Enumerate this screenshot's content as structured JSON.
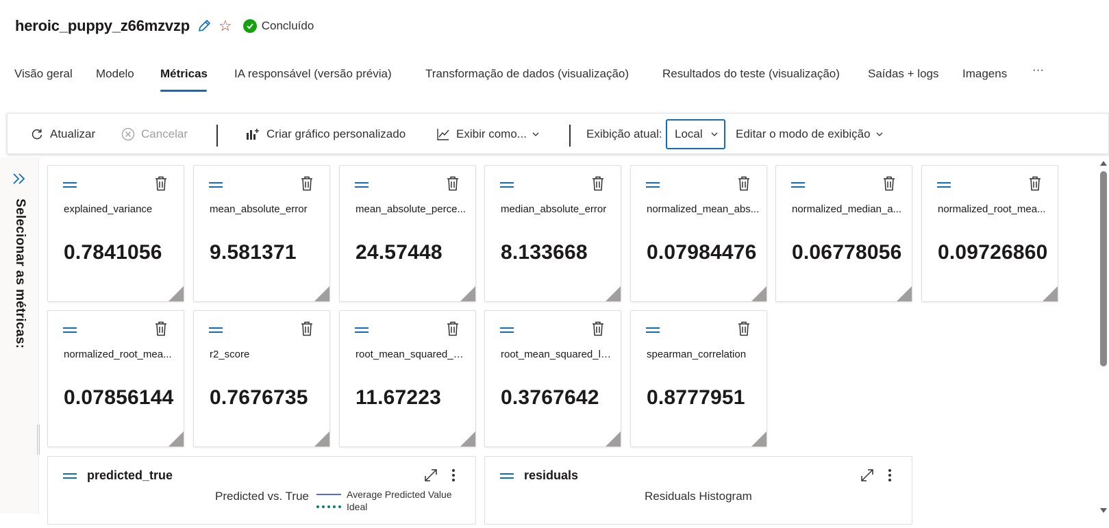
{
  "header": {
    "title": "heroic_puppy_z66mzvzp",
    "status": "Concluído",
    "status_color": "#13a10e",
    "icons": [
      "pencil-icon",
      "star-icon",
      "check-circle-icon"
    ]
  },
  "tabs": [
    {
      "label": "Visão geral",
      "active": false
    },
    {
      "label": "Modelo",
      "active": false
    },
    {
      "label": "Métricas",
      "active": true
    },
    {
      "label": "IA responsável (versão prévia)",
      "active": false
    },
    {
      "label": "Transformação de dados (visualização)",
      "active": false
    },
    {
      "label": "Resultados do teste (visualização)",
      "active": false
    },
    {
      "label": "Saídas + logs",
      "active": false
    },
    {
      "label": "Imagens",
      "active": false
    },
    {
      "label": "···",
      "active": false
    }
  ],
  "toolbar": {
    "refresh": "Atualizar",
    "cancel": "Cancelar",
    "create_chart": "Criar gráfico personalizado",
    "view_as": "Exibir como...",
    "current_view_label": "Exibição atual:",
    "current_view_value": "Local",
    "edit_view": "Editar o modo de exibição"
  },
  "sidebar": {
    "label": "Selecionar as métricas:"
  },
  "metrics": [
    {
      "name": "explained_variance",
      "value": "0.7841056"
    },
    {
      "name": "mean_absolute_error",
      "value": "9.581371"
    },
    {
      "name": "mean_absolute_perce...",
      "value": "24.57448"
    },
    {
      "name": "median_absolute_error",
      "value": "8.133668"
    },
    {
      "name": "normalized_mean_abs...",
      "value": "0.07984476"
    },
    {
      "name": "normalized_median_a...",
      "value": "0.06778056"
    },
    {
      "name": "normalized_root_mea...",
      "value": "0.09726860"
    },
    {
      "name": "normalized_root_mea...",
      "value": "0.07856144"
    },
    {
      "name": "r2_score",
      "value": "0.7676735"
    },
    {
      "name": "root_mean_squared_er...",
      "value": "11.67223"
    },
    {
      "name": "root_mean_squared_lo...",
      "value": "0.3767642"
    },
    {
      "name": "spearman_correlation",
      "value": "0.8777951"
    }
  ],
  "charts": [
    {
      "title": "predicted_true",
      "subtitle": "Predicted vs. True",
      "legend": [
        {
          "label": "Average Predicted Value",
          "color": "#4f6bed"
        },
        {
          "label": "Ideal",
          "color": "#0a7d6c"
        }
      ]
    },
    {
      "title": "residuals",
      "subtitle": "Residuals Histogram"
    }
  ]
}
